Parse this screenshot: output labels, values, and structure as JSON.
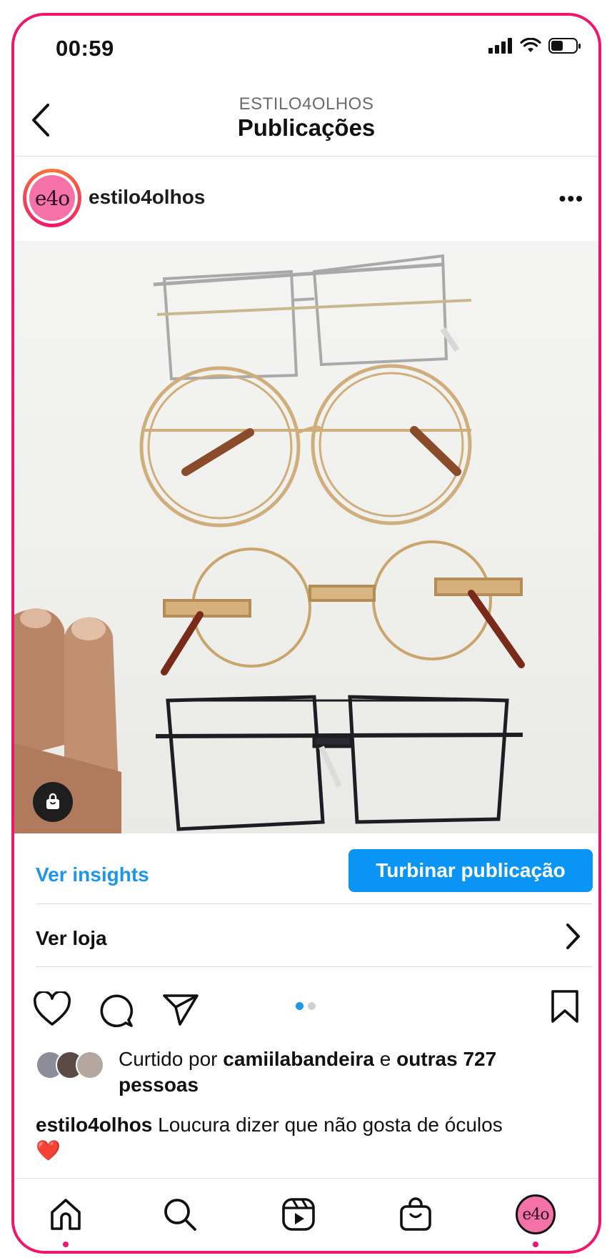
{
  "status_bar": {
    "time": "00:59"
  },
  "header": {
    "account": "ESTILO4OLHOS",
    "title": "Publicações"
  },
  "post": {
    "username": "estilo4olhos",
    "avatar_text": "e4o",
    "more_label": "•••",
    "carousel": {
      "pages": 2,
      "current": 1
    }
  },
  "actions": {
    "insights_label": "Ver insights",
    "boost_label": "Turbinar publicação",
    "shop_label": "Ver loja"
  },
  "likes": {
    "prefix": "Curtido por ",
    "user": "camiilabandeira",
    "middle": " e ",
    "others": "outras 727 pessoas"
  },
  "caption": {
    "user": "estilo4olhos",
    "text": " Loucura dizer que não gosta de óculos",
    "emoji": "❤️"
  },
  "nav": {
    "items": [
      "home-icon",
      "search-icon",
      "reels-icon",
      "shop-icon",
      "profile-avatar"
    ],
    "profile_text": "e4o"
  },
  "colors": {
    "accent": "#0a95f5",
    "link": "#1c96e8",
    "brand": "#f0156d"
  }
}
